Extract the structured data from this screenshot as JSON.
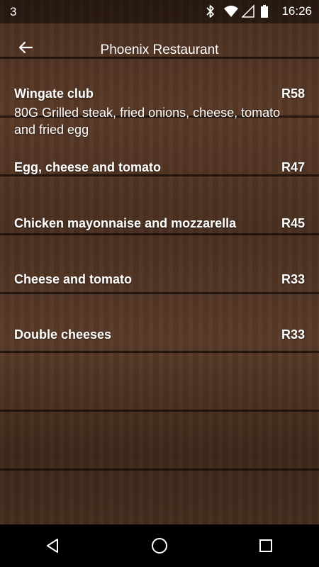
{
  "status_bar": {
    "notification_count": "3",
    "time": "16:26",
    "icons": [
      "bluetooth-icon",
      "wifi-icon",
      "signal-icon",
      "battery-icon"
    ]
  },
  "app_bar": {
    "title": "Phoenix Restaurant",
    "back_icon": "arrow-back-icon"
  },
  "menu": {
    "items": [
      {
        "name": "Wingate club",
        "price": "R58",
        "description": "80G Grilled steak, fried onions, cheese, tomato and fried egg"
      },
      {
        "name": "Egg, cheese and tomato",
        "price": "R47"
      },
      {
        "name": "Chicken mayonnaise and mozzarella",
        "price": "R45"
      },
      {
        "name": "Cheese and tomato",
        "price": "R33"
      },
      {
        "name": "Double cheeses",
        "price": "R33"
      }
    ]
  },
  "nav_bar": {
    "icons": [
      "back-triangle-icon",
      "home-circle-icon",
      "recents-square-icon"
    ]
  }
}
